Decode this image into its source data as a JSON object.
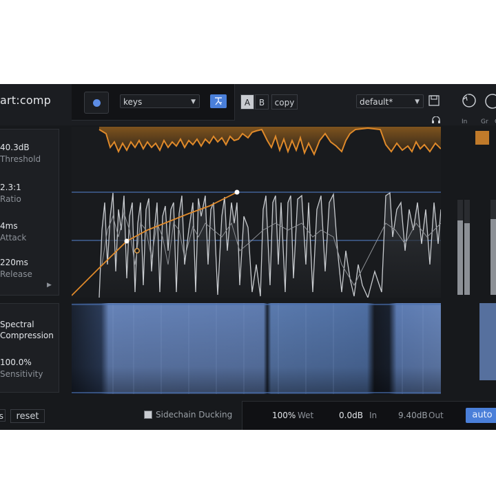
{
  "header": {
    "title": "art:comp",
    "preset_key": "keys",
    "learn_icon": "learn-icon",
    "ab": {
      "a_label": "A",
      "b_label": "B",
      "copy_label": "copy"
    },
    "preset": "default*",
    "icons": [
      "save-icon",
      "undo-icon",
      "headphones-icon"
    ]
  },
  "params": [
    {
      "value": "40.3dB",
      "label": "Threshold"
    },
    {
      "value": "2.3:1",
      "label": "Ratio"
    },
    {
      "value": "4ms",
      "label": "Attack"
    },
    {
      "value": "220ms",
      "label": "Release"
    }
  ],
  "spectral": {
    "title_line1": "Spectral",
    "title_line2": "Compression",
    "value": "100.0%",
    "label": "Sensitivity"
  },
  "meters": {
    "labels": [
      "In",
      "Gr",
      "C"
    ]
  },
  "footer": {
    "left_btn": "s",
    "reset": "reset",
    "sidechain": "Sidechain Ducking",
    "wet_value": "100%",
    "wet_label": "Wet",
    "in_value": "0.0dB",
    "in_label": "In",
    "out_value": "9.40dB",
    "out_label": "Out",
    "auto": "auto"
  },
  "colors": {
    "accent": "#4a7fd9",
    "orange": "#e08a2a",
    "bg": "#17191c"
  }
}
